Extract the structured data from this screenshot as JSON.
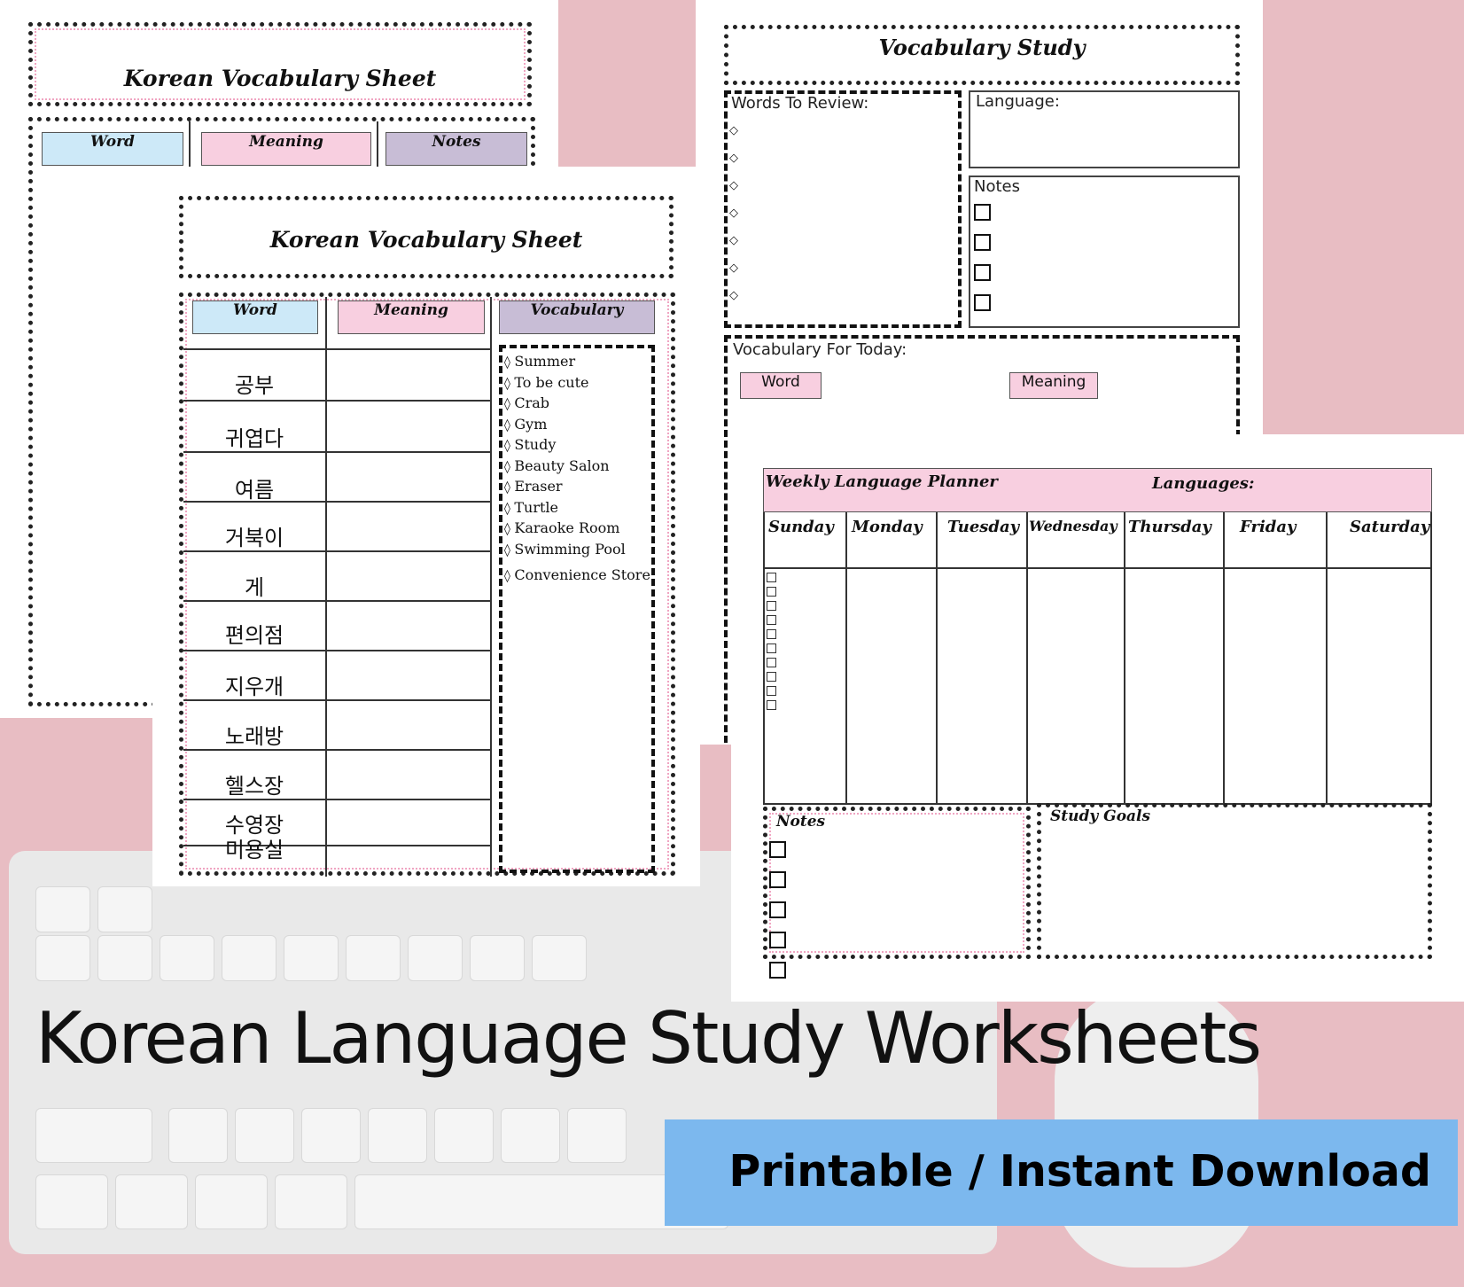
{
  "sheet1": {
    "title": "Korean Vocabulary Sheet",
    "columns": [
      "Word",
      "Meaning",
      "Notes"
    ]
  },
  "sheet2": {
    "title": "Korean Vocabulary Sheet",
    "columns": [
      "Word",
      "Meaning",
      "Vocabulary"
    ],
    "words": [
      "공부",
      "귀엽다",
      "여름",
      "거북이",
      "게",
      "편의점",
      "지우개",
      "노래방",
      "헬스장",
      "수영장",
      "미용실"
    ],
    "vocabulary": [
      "Summer",
      "To be cute",
      "Crab",
      "Gym",
      "Study",
      "Beauty Salon",
      "Eraser",
      "Turtle",
      "Karaoke Room",
      "Swimming Pool",
      "Convenience Store"
    ]
  },
  "study": {
    "title": "Vocabulary Study",
    "words_to_review": "Words To Review:",
    "language": "Language:",
    "notes": "Notes",
    "vocab_today": "Vocabulary For Today:",
    "word": "Word",
    "meaning": "Meaning"
  },
  "planner": {
    "title": "Weekly Language Planner",
    "languages": "Languages:",
    "days": [
      "Sunday",
      "Monday",
      "Tuesday",
      "Wednesday",
      "Thursday",
      "Friday",
      "Saturday"
    ],
    "notes": "Notes",
    "study_goals": "Study Goals"
  },
  "banner": {
    "headline": "Korean Language Study Worksheets",
    "cta": "Printable / Instant Download",
    "cta_color": "#7cb8ee"
  },
  "colors": {
    "blue": "#cde9f8",
    "pink": "#f8cfe0",
    "purple": "#c8bdd6",
    "background": "#e8bdc3"
  }
}
